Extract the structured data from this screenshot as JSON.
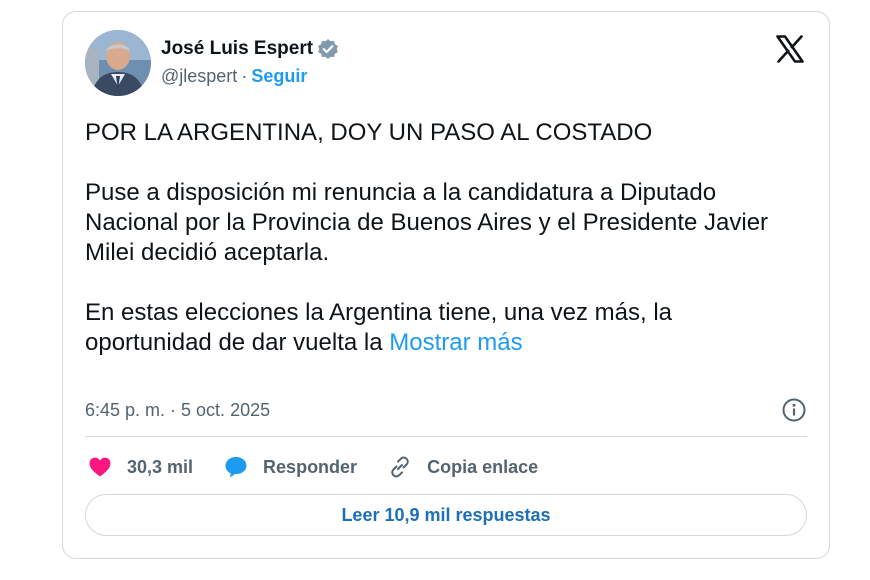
{
  "author": {
    "name": "José Luis Espert",
    "handle": "@jlespert",
    "separator": "·",
    "follow_label": "Seguir",
    "verified": true
  },
  "post": {
    "paragraphs": [
      "POR LA ARGENTINA, DOY UN PASO AL COSTADO",
      "Puse a disposición mi renuncia a la candidatura a Diputado Nacional por la Provincia de Buenos Aires y el Presidente Javier Milei decidió aceptarla.",
      "En estas elecciones la Argentina tiene, una vez más, la oportunidad de dar vuelta la"
    ],
    "show_more_label": "Mostrar más",
    "timestamp": "6:45 p. m. · 5 oct. 2025"
  },
  "actions": {
    "likes": "30,3 mil",
    "reply_label": "Responder",
    "copy_link_label": "Copia enlace"
  },
  "replies_button_label": "Leer 10,9 mil respuestas",
  "icons": {
    "logo": "x-logo-icon",
    "verified": "verified-badge-icon",
    "info": "info-icon",
    "like": "heart-icon",
    "reply": "reply-bubble-icon",
    "link": "link-icon"
  },
  "colors": {
    "accent": "#1d9bf0",
    "like": "#f91880",
    "text": "#0f1419",
    "muted": "#536471",
    "border": "#cfd9de"
  }
}
